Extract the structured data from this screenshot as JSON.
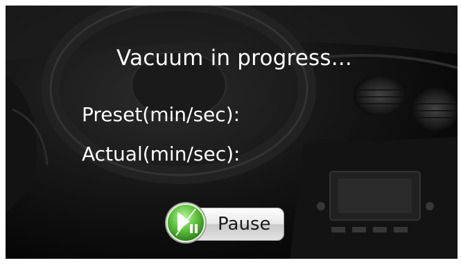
{
  "screen": {
    "title": "Vacuum in progress...",
    "preset_label": "Preset(min/sec):",
    "actual_label": "Actual(min/sec):"
  },
  "pause_button": {
    "label": "Pause",
    "icon": "play-pause-icon",
    "accent_color": "#5cc03a"
  },
  "colors": {
    "text": "#ffffff",
    "background": "#0b0b0b"
  }
}
